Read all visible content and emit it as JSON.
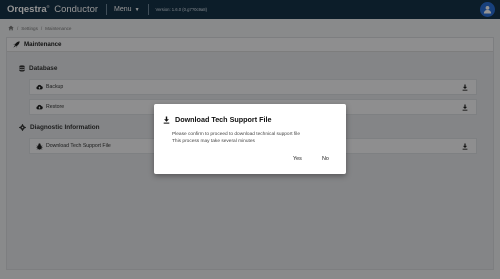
{
  "header": {
    "brand_main": "Orqestra",
    "brand_mark": "®",
    "brand_sub": "Conductor",
    "menu_label": "Menu",
    "version": "Version: 1.6.0 (0.g7?0c9a8)",
    "icons": {
      "user": "user-icon",
      "menu_caret": "chevron-down-icon"
    },
    "colors": {
      "bar": "#163248",
      "user_button": "#2a6fd6"
    }
  },
  "breadcrumb": {
    "items": [
      "Settings",
      "Maintenance"
    ],
    "separator": "/",
    "home_icon": "home-icon"
  },
  "panel": {
    "title": "Maintenance",
    "icon": "rocket-icon"
  },
  "sections": [
    {
      "title": "Database",
      "icon": "database-icon",
      "items": [
        {
          "label": "Backup",
          "icon": "cloud-upload-icon",
          "action_icon": "download-icon"
        },
        {
          "label": "Restore",
          "icon": "cloud-download-icon",
          "action_icon": "download-icon"
        }
      ]
    },
    {
      "title": "Diagnostic Information",
      "icon": "gear-icon",
      "items": [
        {
          "label": "Download Tech Support File",
          "icon": "bug-icon",
          "action_icon": "download-icon"
        }
      ]
    }
  ],
  "dialog": {
    "title": "Download Tech Support File",
    "icon": "download-icon",
    "message_line1": "Please confirm to proceed to download technical support file",
    "message_line2": "This process may take several minutes",
    "yes_label": "Yes",
    "no_label": "No"
  }
}
